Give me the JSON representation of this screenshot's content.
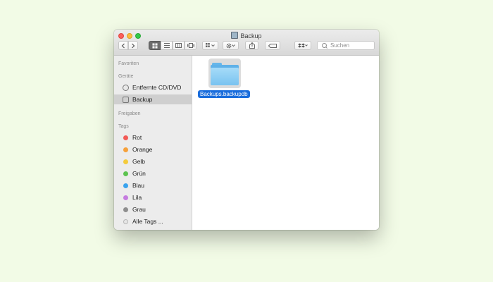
{
  "window": {
    "title": "Backup"
  },
  "toolbar": {
    "back_icon": "chevron-left-icon",
    "forward_icon": "chevron-right-icon",
    "search_placeholder": "Suchen"
  },
  "sidebar": {
    "sections": {
      "favorites": "Favoriten",
      "devices": "Geräte",
      "shared": "Freigaben",
      "tags": "Tags"
    },
    "devices": [
      {
        "label": "Entfernte CD/DVD",
        "icon": "disc-icon"
      },
      {
        "label": "Backup",
        "icon": "drive-icon",
        "selected": true
      }
    ],
    "tags": [
      {
        "label": "Rot",
        "color": "#f25a56"
      },
      {
        "label": "Orange",
        "color": "#f6a13a"
      },
      {
        "label": "Gelb",
        "color": "#f4cb3c"
      },
      {
        "label": "Grün",
        "color": "#5cc34f"
      },
      {
        "label": "Blau",
        "color": "#3aa3ee"
      },
      {
        "label": "Lila",
        "color": "#c57be0"
      },
      {
        "label": "Grau",
        "color": "#8e8e8e"
      },
      {
        "label": "Alle Tags ...",
        "color": "#e6e6e6"
      }
    ]
  },
  "content": {
    "items": [
      {
        "name": "Backups.backupdb",
        "icon": "folder-icon",
        "selected": true
      }
    ]
  }
}
